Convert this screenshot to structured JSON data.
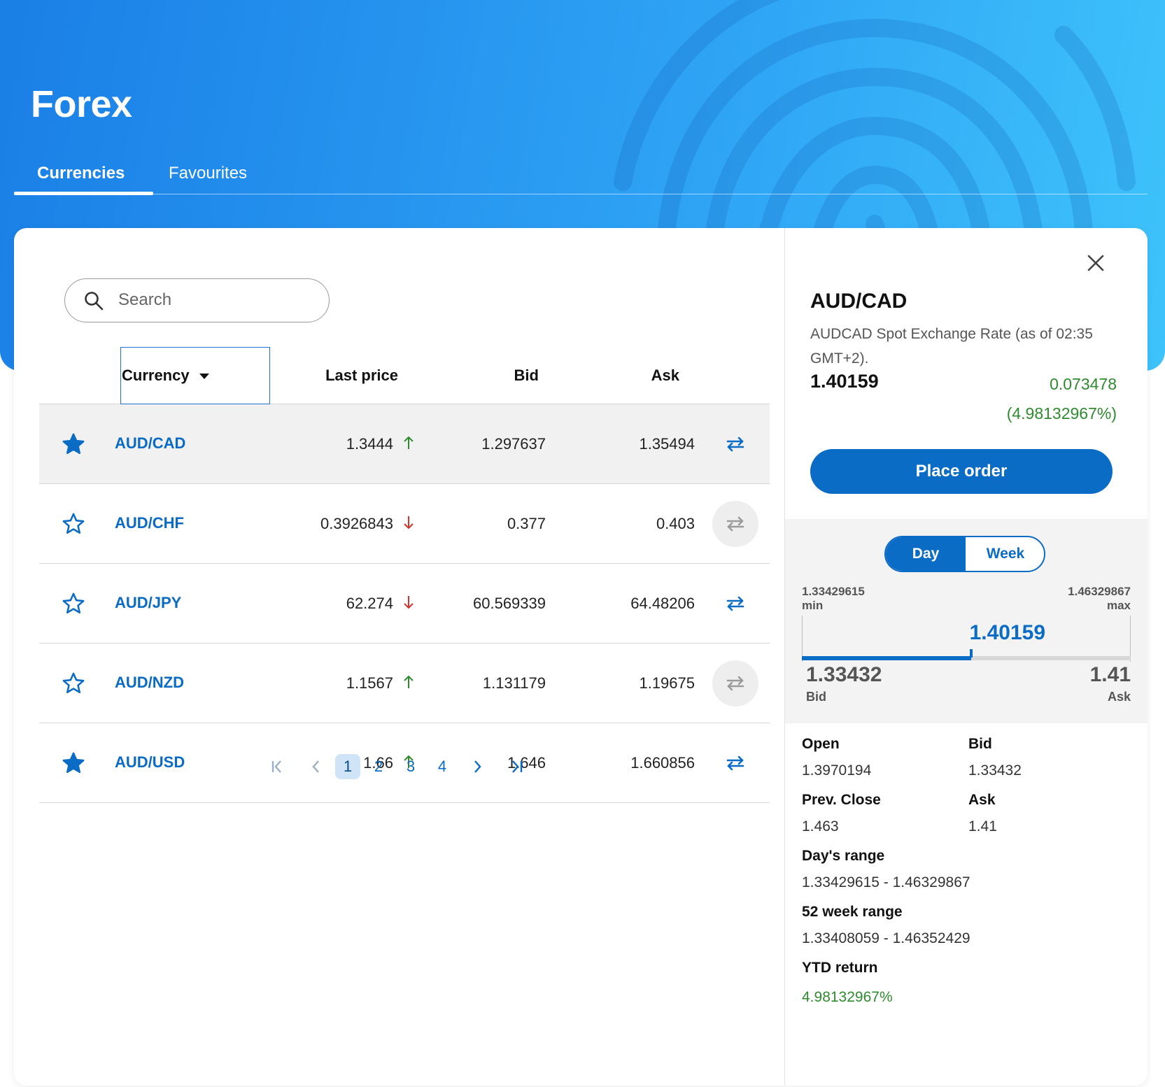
{
  "header": {
    "title": "Forex",
    "tabs": [
      {
        "label": "Currencies",
        "active": true
      },
      {
        "label": "Favourites",
        "active": false
      }
    ]
  },
  "search": {
    "placeholder": "Search",
    "value": ""
  },
  "table": {
    "columns": {
      "currency": "Currency",
      "last_price": "Last price",
      "bid": "Bid",
      "ask": "Ask"
    },
    "rows": [
      {
        "pair": "AUD/CAD",
        "last": "1.3444",
        "trend": "up",
        "bid": "1.297637",
        "ask": "1.35494",
        "favourite": true,
        "selected": true
      },
      {
        "pair": "AUD/CHF",
        "last": "0.3926843",
        "trend": "down",
        "bid": "0.377",
        "ask": "0.403",
        "favourite": false,
        "selected": false
      },
      {
        "pair": "AUD/JPY",
        "last": "62.274",
        "trend": "down",
        "bid": "60.569339",
        "ask": "64.48206",
        "favourite": false,
        "selected": false
      },
      {
        "pair": "AUD/NZD",
        "last": "1.1567",
        "trend": "up",
        "bid": "1.131179",
        "ask": "1.19675",
        "favourite": false,
        "selected": false
      },
      {
        "pair": "AUD/USD",
        "last": "1.66",
        "trend": "up",
        "bid": "1.646",
        "ask": "1.660856",
        "favourite": true,
        "selected": false
      }
    ]
  },
  "pagination": {
    "pages": [
      "1",
      "2",
      "3",
      "4"
    ],
    "current": "1"
  },
  "detail": {
    "pair": "AUD/CAD",
    "description": "AUDCAD Spot Exchange Rate (as of 02:35 GMT+2).",
    "price": "1.40159",
    "change": "0.073478",
    "change_pct": "(4.98132967%)",
    "place_order": "Place order",
    "range_toggle": {
      "day": "Day",
      "week": "Week",
      "active": "Day"
    },
    "range": {
      "min": "1.33429615",
      "min_label": "min",
      "max": "1.46329867",
      "max_label": "max",
      "current": "1.40159",
      "current_fraction": 0.514,
      "bid": "1.33432",
      "bid_label": "Bid",
      "ask": "1.41",
      "ask_label": "Ask"
    },
    "stats": {
      "open_label": "Open",
      "open": "1.3970194",
      "bid_label": "Bid",
      "bid": "1.33432",
      "prev_close_label": "Prev. Close",
      "prev_close": "1.463",
      "ask_label": "Ask",
      "ask": "1.41",
      "days_range_label": "Day's range",
      "days_range": "1.33429615 - 1.46329867",
      "week52_label": "52 week range",
      "week52": "1.33408059 - 1.46352429",
      "ytd_label": "YTD return",
      "ytd": "4.98132967%"
    }
  },
  "colors": {
    "accent": "#0b6cc6",
    "positive": "#2e8b2e",
    "negative": "#d0342c",
    "hero_start": "#1a7fe6",
    "hero_end": "#3ec3fb"
  }
}
